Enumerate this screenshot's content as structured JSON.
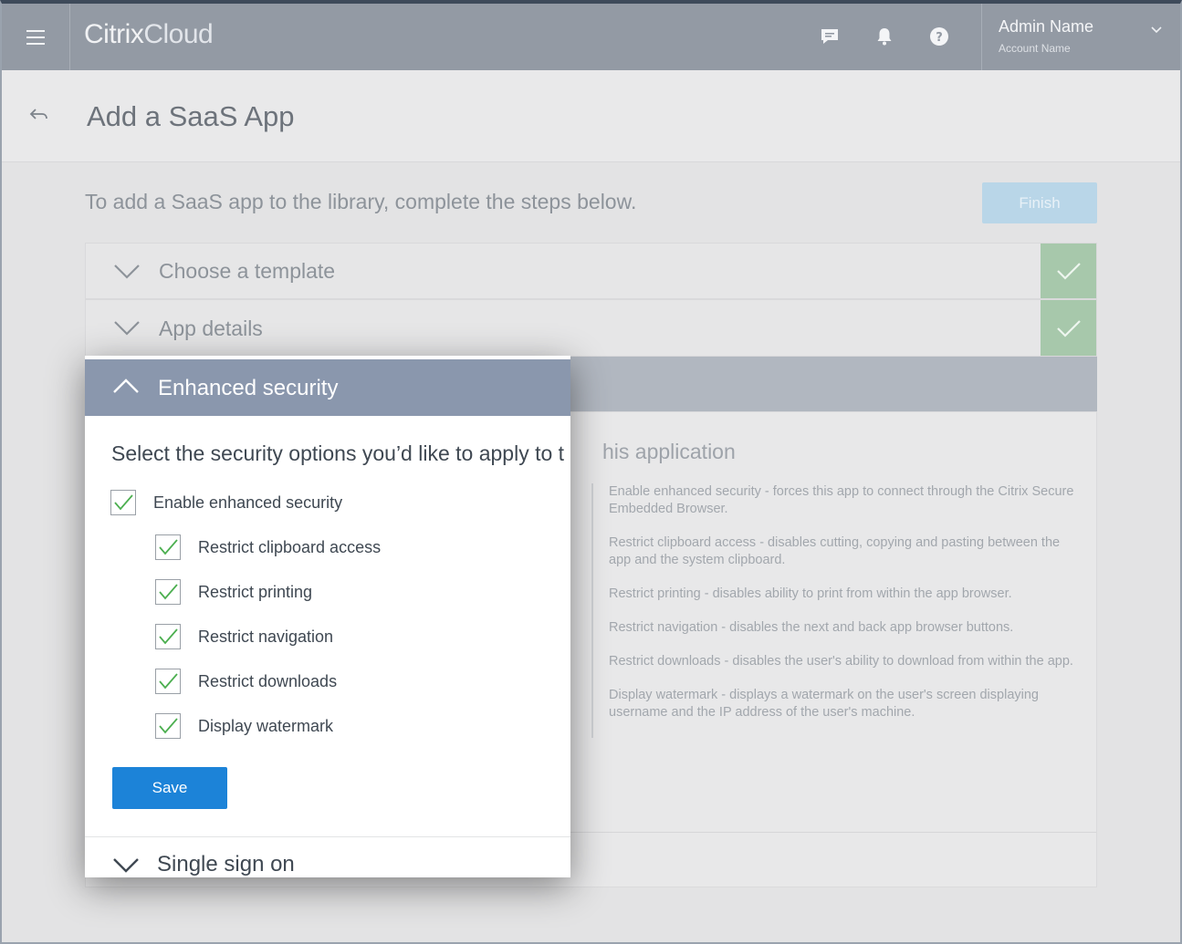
{
  "header": {
    "brand_primary": "Citrix",
    "brand_secondary": "Cloud",
    "user_name": "Admin Name",
    "account_name": "Account Name"
  },
  "page": {
    "title": "Add a SaaS App",
    "intro": "To add a SaaS app to the library, complete the steps below.",
    "finish_label": "Finish"
  },
  "steps": [
    {
      "label": "Choose a template",
      "complete": true
    },
    {
      "label": "App details",
      "complete": true
    },
    {
      "label": "Enhanced security",
      "expanded": true
    },
    {
      "label": "Single sign on"
    }
  ],
  "security": {
    "heading_visible": "Select the security options you’d like to apply to t",
    "heading_rest": "his application",
    "options": [
      {
        "label": "Enable enhanced security",
        "checked": true
      },
      {
        "label": "Restrict clipboard access",
        "checked": true
      },
      {
        "label": "Restrict printing",
        "checked": true
      },
      {
        "label": "Restrict navigation",
        "checked": true
      },
      {
        "label": "Restrict downloads",
        "checked": true
      },
      {
        "label": "Display watermark",
        "checked": true
      }
    ],
    "save_label": "Save",
    "descriptions": [
      "Enable enhanced security - forces this app to connect through the Citrix Secure Embedded Browser.",
      "Restrict clipboard access - disables cutting, copying and pasting between the app and the system clipboard.",
      "Restrict printing - disables ability to print from within the app browser.",
      "Restrict navigation - disables the next and back app browser buttons.",
      "Restrict downloads - disables the user's ability to download from within the app.",
      "Display watermark - displays a watermark on the user's screen displaying username and the IP address of the user's machine."
    ]
  },
  "colors": {
    "topbar": "#939aa4",
    "accent_blue": "#1c83d8",
    "success_green": "#a7c8ab",
    "section_header": "#8a97ad"
  }
}
